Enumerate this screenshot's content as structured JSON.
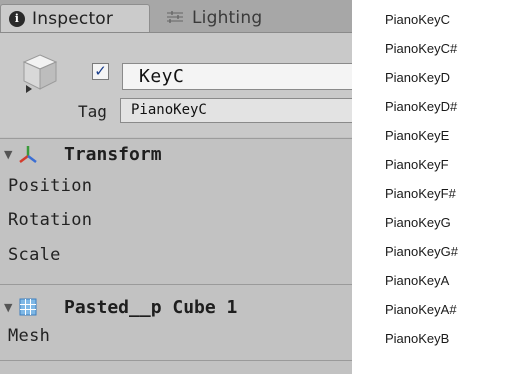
{
  "tabs": {
    "inspector_label": "Inspector",
    "lighting_label": "Lighting",
    "info_glyph": "i"
  },
  "object": {
    "active_checked": true,
    "name": "KeyC",
    "tag_label": "Tag",
    "tag_value": "PianoKeyC"
  },
  "transform": {
    "title": "Transform",
    "position_label": "Position",
    "rotation_label": "Rotation",
    "scale_label": "Scale"
  },
  "mesh_filter": {
    "title": "Pasted__p Cube 1",
    "mesh_label": "Mesh"
  },
  "tag_list": [
    "PianoKeyC",
    "PianoKeyC#",
    "PianoKeyD",
    "PianoKeyD#",
    "PianoKeyE",
    "PianoKeyF",
    "PianoKeyF#",
    "PianoKeyG",
    "PianoKeyG#",
    "PianoKeyA",
    "PianoKeyA#",
    "PianoKeyB"
  ],
  "icons": {
    "info": "info-icon",
    "lighting": "lighting-icon",
    "gameobject": "cube-icon",
    "transform": "transform-axes-icon",
    "mesh": "mesh-filter-icon"
  },
  "colors": {
    "panel_bg": "#c2c2c2",
    "tab_bg": "#a7a7a7",
    "popup_bg": "#ffffff"
  }
}
